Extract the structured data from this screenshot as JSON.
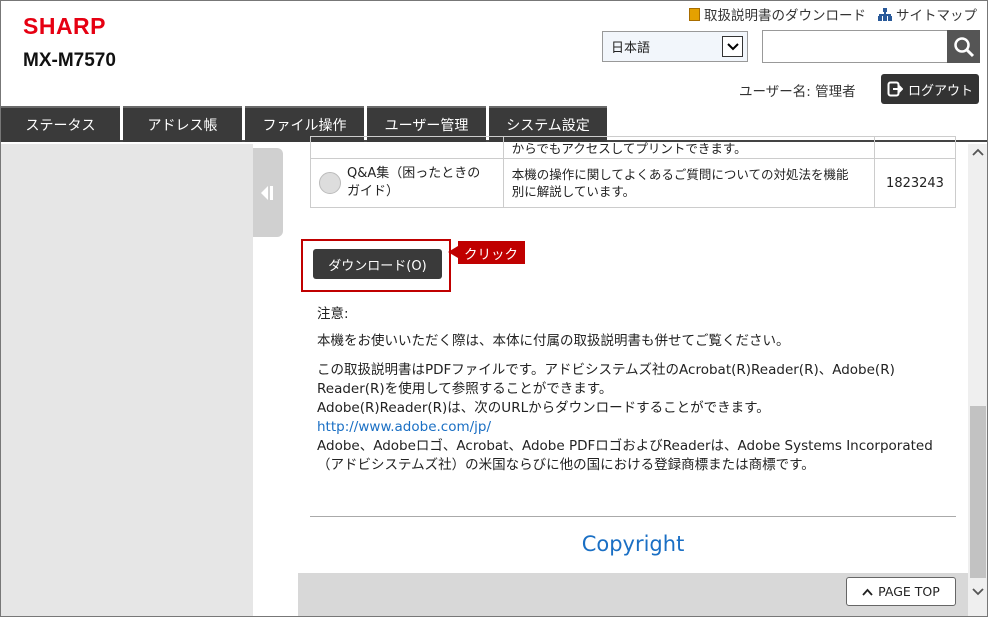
{
  "header": {
    "brand": "SHARP",
    "model": "MX-M7570",
    "links": {
      "manual_download": "取扱説明書のダウンロード",
      "sitemap": "サイトマップ"
    },
    "language": "日本語",
    "search_placeholder": "",
    "username": "ユーザー名: 管理者",
    "logout_label": "ログアウト"
  },
  "tabs": [
    "ステータス",
    "アドレス帳",
    "ファイル操作",
    "ユーザー管理",
    "システム設定"
  ],
  "table": {
    "rows": [
      {
        "name": "",
        "desc": "からでもアクセスしてプリントできます。",
        "code": ""
      },
      {
        "name_line1": "Q&A集（困ったときの",
        "name_line2": "ガイド）",
        "desc_line1": "本機の操作に関してよくあるご質問についての対処法を機能",
        "desc_line2": "別に解説しています。",
        "code": "1823243"
      }
    ]
  },
  "download_button": "ダウンロード(O)",
  "callout": "クリック",
  "notes": {
    "heading": "注意:",
    "line1": "本機をお使いいただく際は、本体に付属の取扱説明書も併せてご覧ください。",
    "p2_line1": "この取扱説明書はPDFファイルです。アドビシステムズ社のAcrobat(R)Reader(R)、Adobe(R)",
    "p2_line2": "Reader(R)を使用して参照することができます。",
    "p2_line3": "Adobe(R)Reader(R)は、次のURLからダウンロードすることができます。",
    "url": "http://www.adobe.com/jp/",
    "p2_line4": "Adobe、Adobeロゴ、Acrobat、Adobe PDFロゴおよびReaderは、Adobe Systems Incorporated",
    "p2_line5": "（アドビシステムズ社）の米国ならびに他の国における登録商標または商標です。"
  },
  "copyright": "Copyright",
  "page_top": "PAGE TOP"
}
